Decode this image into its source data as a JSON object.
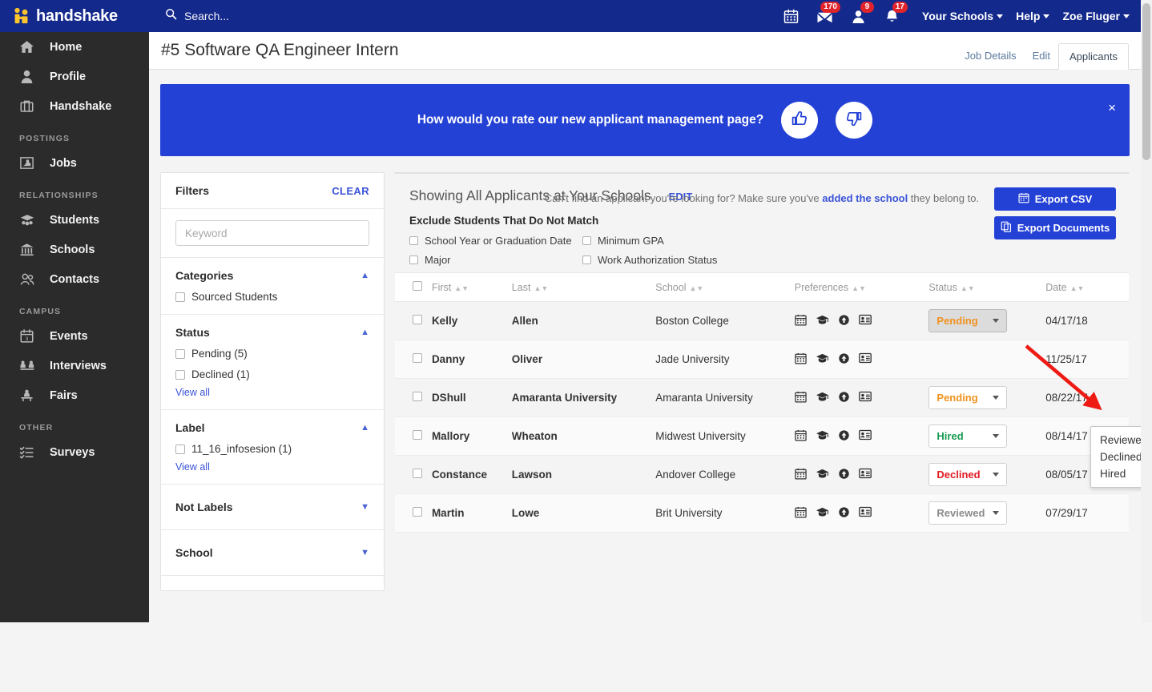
{
  "topnav": {
    "brand": "handshake",
    "search_label": "Search...",
    "icons": [
      {
        "name": "calendar-icon",
        "badge": null
      },
      {
        "name": "messages-icon",
        "badge": "170"
      },
      {
        "name": "profile-icon",
        "badge": "9"
      },
      {
        "name": "notifications-icon",
        "badge": "17"
      }
    ],
    "links": [
      "Your Schools",
      "Help",
      "Zoe Fluger"
    ]
  },
  "sidebar": {
    "items": [
      {
        "label": "Home",
        "icon": "home-icon",
        "type": "item"
      },
      {
        "label": "Profile",
        "icon": "person-icon",
        "type": "item"
      },
      {
        "label": "Handshake",
        "icon": "briefcase-icon",
        "type": "item"
      },
      {
        "label": "POSTINGS",
        "type": "header"
      },
      {
        "label": "Jobs",
        "icon": "jobs-icon",
        "type": "item"
      },
      {
        "label": "RELATIONSHIPS",
        "type": "header"
      },
      {
        "label": "Students",
        "icon": "students-icon",
        "type": "item"
      },
      {
        "label": "Schools",
        "icon": "bank-icon",
        "type": "item"
      },
      {
        "label": "Contacts",
        "icon": "contacts-icon",
        "type": "item"
      },
      {
        "label": "CAMPUS",
        "type": "header"
      },
      {
        "label": "Events",
        "icon": "events-calendar-icon",
        "type": "item"
      },
      {
        "label": "Interviews",
        "icon": "interviews-icon",
        "type": "item"
      },
      {
        "label": "Fairs",
        "icon": "fairs-icon",
        "type": "item"
      },
      {
        "label": "OTHER",
        "type": "header"
      },
      {
        "label": "Surveys",
        "icon": "surveys-icon",
        "type": "item"
      }
    ]
  },
  "page": {
    "title": "#5 Software QA Engineer Intern",
    "tabs": [
      {
        "label": "Job Details",
        "active": false
      },
      {
        "label": "Edit",
        "active": false
      },
      {
        "label": "Applicants",
        "active": true
      }
    ]
  },
  "banner": {
    "question": "How would you rate our new applicant management page?",
    "thumbs_up": "thumbs-up-icon",
    "thumbs_down": "thumbs-down-icon",
    "close": "×",
    "color": "#2441d6"
  },
  "filters": {
    "title": "Filters",
    "clear_label": "CLEAR",
    "keyword_placeholder": "Keyword",
    "keyword_value": "",
    "sections": [
      {
        "title": "Categories",
        "expanded": true,
        "options": [
          {
            "label": "Sourced Students",
            "checked": false
          }
        ],
        "view_all": null
      },
      {
        "title": "Status",
        "expanded": true,
        "options": [
          {
            "label": "Pending (5)",
            "checked": false
          },
          {
            "label": "Declined (1)",
            "checked": false
          }
        ],
        "view_all": "View all"
      },
      {
        "title": "Label",
        "expanded": true,
        "options": [
          {
            "label": "11_16_infosesion (1)",
            "checked": false
          }
        ],
        "view_all": "View all"
      },
      {
        "title": "Not Labels",
        "expanded": false,
        "options": [],
        "view_all": null
      },
      {
        "title": "School",
        "expanded": false,
        "options": [],
        "view_all": null
      }
    ]
  },
  "applicants": {
    "showing_text": "Showing All Applicants at Your Schools",
    "edit_label": "EDIT",
    "export_csv_label": "Export CSV",
    "export_documents_label": "Export Documents",
    "exclude_title": "Exclude Students That Do Not Match",
    "exclude_options": [
      {
        "label": "School Year or Graduation Date",
        "checked": false
      },
      {
        "label": "Minimum GPA",
        "checked": false
      },
      {
        "label": "Major",
        "checked": false
      },
      {
        "label": "Work Authorization Status",
        "checked": false
      }
    ],
    "columns": [
      "First",
      "Last",
      "School",
      "Preferences",
      "Status",
      "Date"
    ],
    "preference_icons": [
      "calendar-icon",
      "graduation-cap-icon",
      "upload-icon",
      "id-card-icon"
    ],
    "rows": [
      {
        "first": "Kelly",
        "last": "Allen",
        "school": "Boston College",
        "status": "Pending",
        "status_color": "#f0921e",
        "date": "04/17/18",
        "menu_open": true
      },
      {
        "first": "Danny",
        "last": "Oliver",
        "school": "Jade University",
        "status": "",
        "status_color": "#f0921e",
        "date": "11/25/17",
        "menu_open": false
      },
      {
        "first": "DShull",
        "last": "Amaranta University",
        "school": "Amaranta University",
        "status": "Pending",
        "status_color": "#f0921e",
        "date": "08/22/17",
        "menu_open": false
      },
      {
        "first": "Mallory",
        "last": "Wheaton",
        "school": "Midwest University",
        "status": "Hired",
        "status_color": "#1a9a52",
        "date": "08/14/17",
        "menu_open": false
      },
      {
        "first": "Constance",
        "last": "Lawson",
        "school": "Andover College",
        "status": "Declined",
        "status_color": "#e11b22",
        "date": "08/05/17",
        "menu_open": false
      },
      {
        "first": "Martin",
        "last": "Lowe",
        "school": "Brit University",
        "status": "Reviewed",
        "status_color": "#8a8a8a",
        "date": "07/29/17",
        "menu_open": false
      }
    ],
    "status_menu": [
      "Reviewed",
      "Declined",
      "Hired"
    ],
    "footnote_before": "Can't find an applicant you're looking for? Make sure you've ",
    "footnote_link": "added the school",
    "footnote_after": " they belong to."
  },
  "annotation": {
    "color": "#ee1b14",
    "name": "red-arrow-pointing-to-status-dropdown"
  }
}
